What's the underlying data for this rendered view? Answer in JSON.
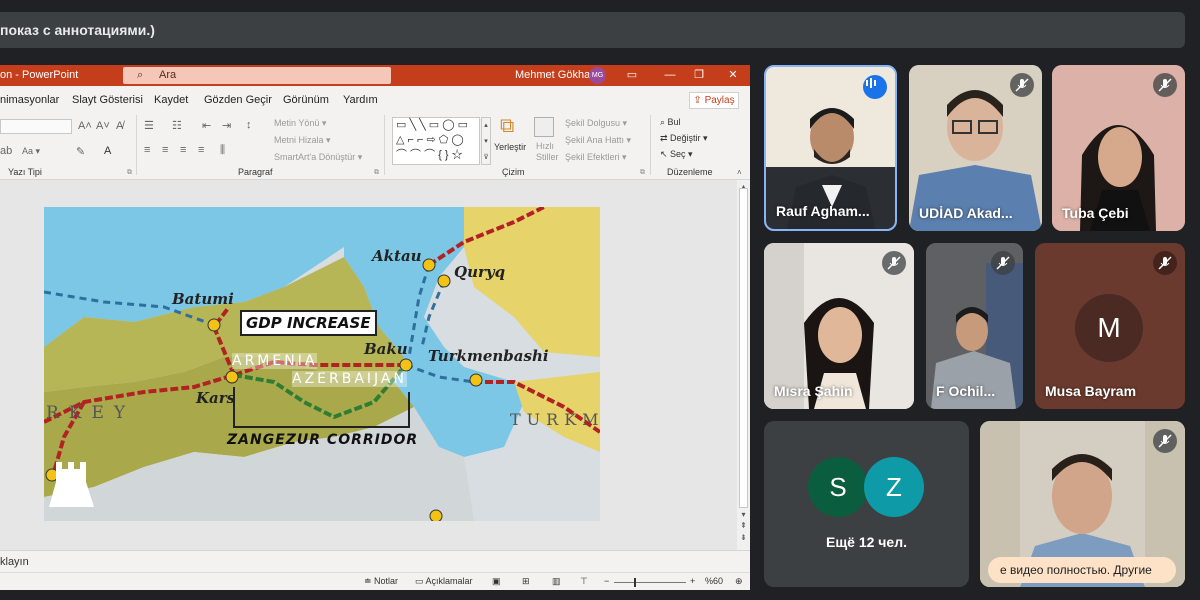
{
  "banner": {
    "text": "показ с аннотациями.)"
  },
  "powerpoint": {
    "app_title": "on - PowerPoint",
    "search_placeholder": "Ara",
    "user_name": "Mehmet Gökhan",
    "user_initials": "MG",
    "tabs": [
      "nimasyonlar",
      "Slayt Gösterisi",
      "Kaydet",
      "Gözden Geçir",
      "Görünüm",
      "Yardım"
    ],
    "share_label": "Paylaş",
    "ribbon": {
      "groups": [
        "Yazı Tipi",
        "Paragraf",
        "Çizim",
        "Düzenleme"
      ],
      "paragraph_items": [
        "Metin Yönü ▾",
        "Metni Hizala ▾",
        "SmartArt'a Dönüştür ▾"
      ],
      "drawing_items": [
        "Yerleştir",
        "Hızlı Stiller"
      ],
      "shape_items": [
        "Şekil Dolgusu ▾",
        "Şekil Ana Hattı ▾",
        "Şekil Efektleri ▾"
      ],
      "edit_items": [
        "Bul",
        "Değiştir ▾",
        "Seç ▾"
      ],
      "font_labels": [
        "Aa ▾"
      ]
    },
    "notes_label": "klayın",
    "status": {
      "notes": "Notlar",
      "comments": "Açıklamalar",
      "zoom": "%60"
    },
    "slide": {
      "labels": {
        "aktau": "Aktau",
        "quryq": "Quryq",
        "batumi": "Batumi",
        "gdp": "GDP INCREASE",
        "baku": "Baku",
        "turkmenbashi": "Turkmenbashi",
        "armenia": "ARMENIA",
        "azerbaijan": "AZERBAIJAN",
        "kars": "Kars",
        "turkey": "RKEY",
        "zangezur": "ZANGEZUR CORRIDOR",
        "turkm": "TURKM"
      }
    }
  },
  "participants": [
    {
      "name": "Rauf Agham...",
      "speaking": true
    },
    {
      "name": "UDİAD Akad...",
      "muted": true
    },
    {
      "name": "Tuba Çebi",
      "muted": true
    },
    {
      "name": "Mısra Şahin",
      "muted": true
    },
    {
      "name": "F Ochil...",
      "muted": true
    },
    {
      "name": "Musa Bayram",
      "muted": true,
      "initial": "M"
    }
  ],
  "others": {
    "avatars": [
      "S",
      "Z"
    ],
    "label": "Ещё 12 чел.",
    "colors": [
      "#0b5d3f",
      "#0f9aa8"
    ]
  },
  "last_tile": {
    "toast": "е видео полностью. Другие"
  }
}
